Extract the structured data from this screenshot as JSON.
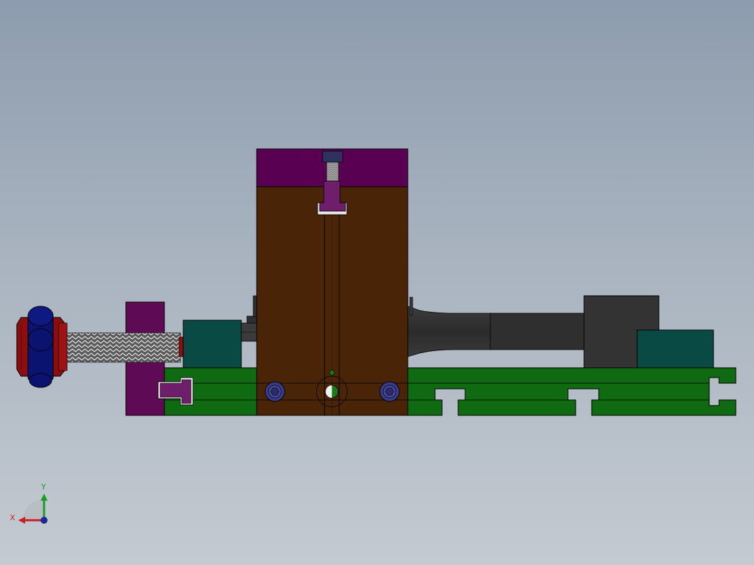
{
  "triad": {
    "x_label": "X",
    "y_label": "Y",
    "x_color": "#cc1f1f",
    "y_color": "#1a9a2a",
    "z_color": "#1a2a9a"
  },
  "colors": {
    "background_top": "#8d9cae",
    "background_bottom": "#c4cad1",
    "base_rail": "#0f6a12",
    "main_block": "#4a2406",
    "top_cap": "#5a0052",
    "clamp_plate": "#5e0a55",
    "dark_tube": "#333333",
    "teal_block": "#0a4a44",
    "handle_red": "#8a0e10",
    "handle_blue": "#0a1470",
    "bolt_head": "#3a3a8a"
  }
}
